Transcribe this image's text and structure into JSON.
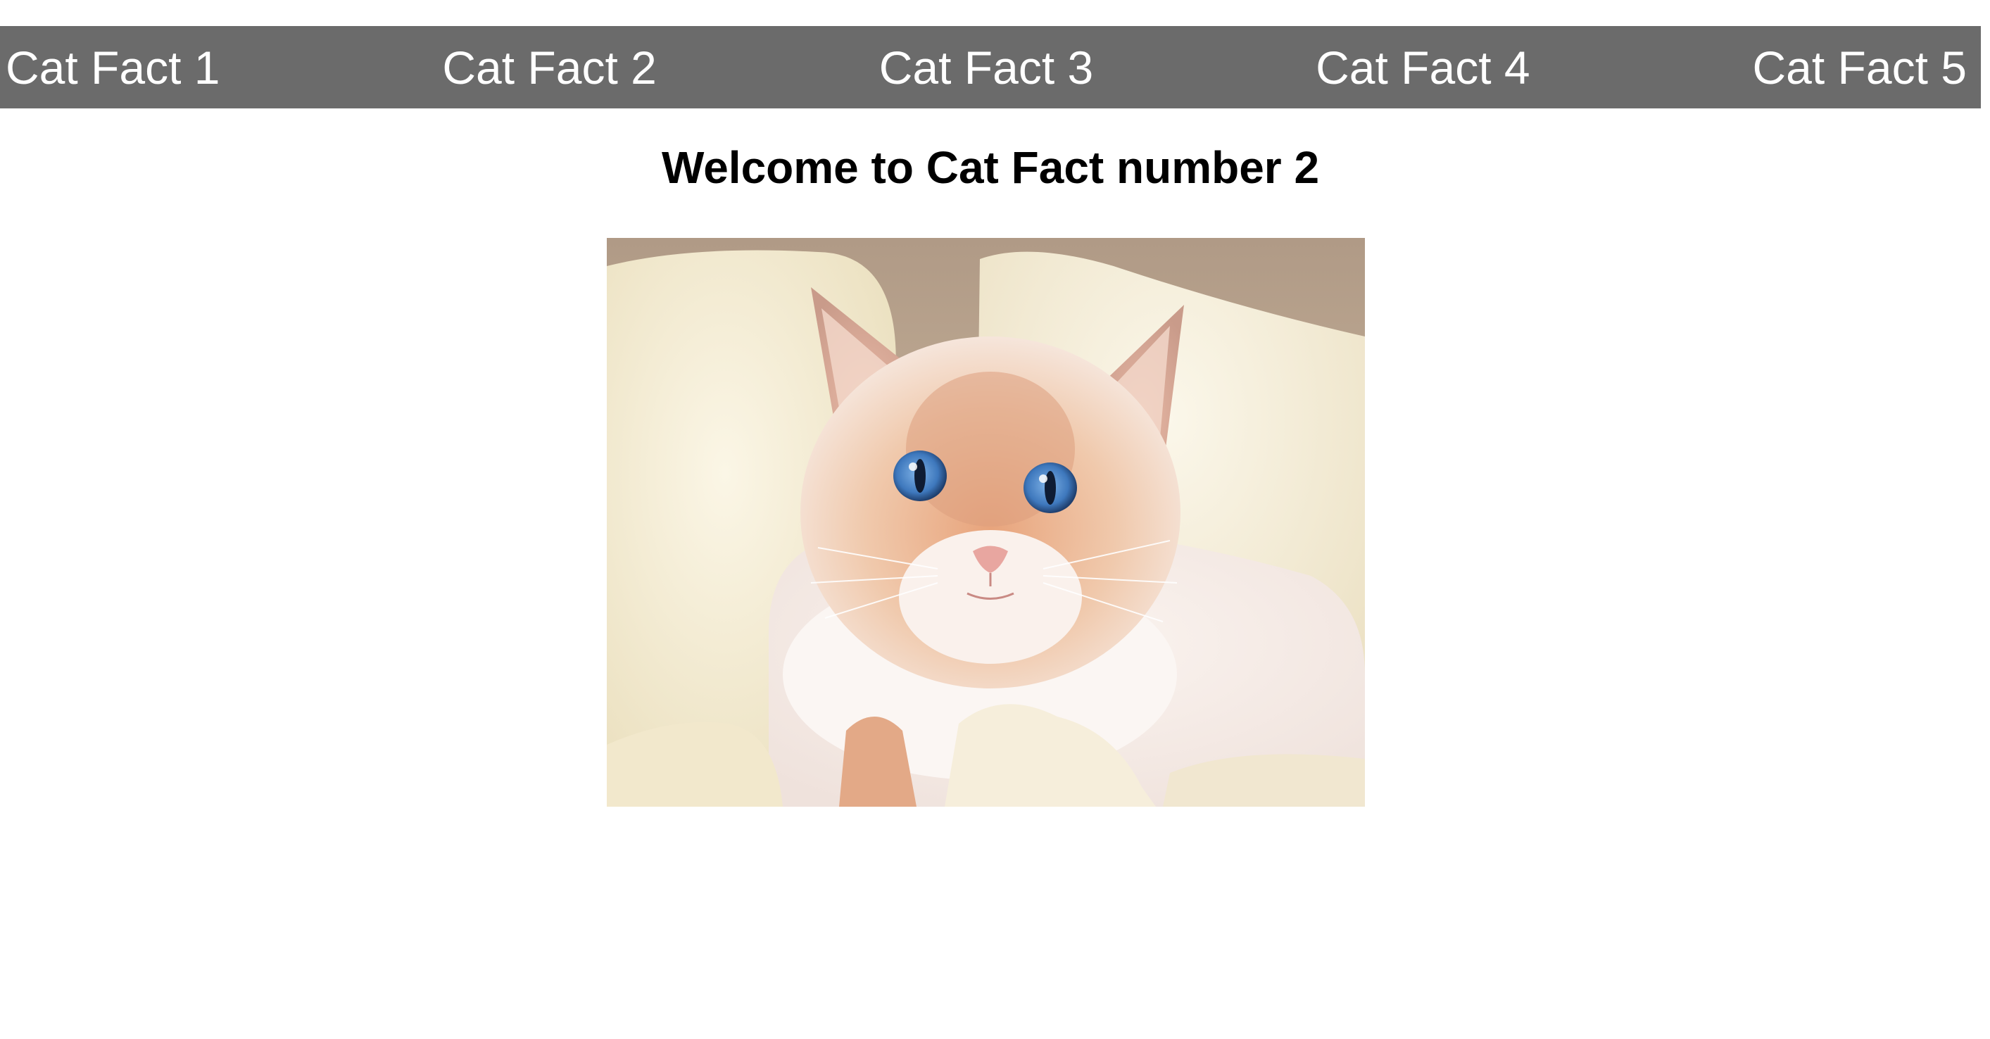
{
  "nav": {
    "items": [
      {
        "label": "Cat Fact 1"
      },
      {
        "label": "Cat Fact 2"
      },
      {
        "label": "Cat Fact 3"
      },
      {
        "label": "Cat Fact 4"
      },
      {
        "label": "Cat Fact 5"
      }
    ],
    "background_color": "#6b6b6b",
    "text_color": "#ffffff"
  },
  "main": {
    "heading": "Welcome to Cat Fact number 2",
    "photo": {
      "subject": "cat-photo",
      "colors": {
        "wall": "#b49c86",
        "blanket": "#f3ecd6",
        "fur_light": "#f6ece6",
        "fur_orange": "#e0a57f",
        "eyes": "#3f7fc4"
      }
    }
  }
}
